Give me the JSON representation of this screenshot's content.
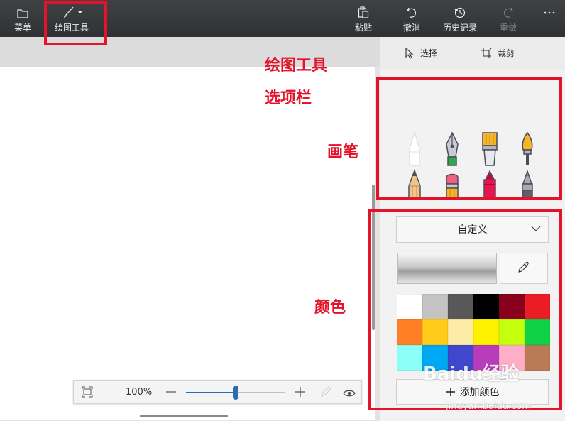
{
  "toolbar": {
    "menu_label": "菜单",
    "draw_tools_label": "绘图工具",
    "paste_label": "粘贴",
    "undo_label": "撤消",
    "history_label": "历史记录",
    "redo_label": "重做"
  },
  "zoom": {
    "percent_text": "100%",
    "level": 0.5
  },
  "pane": {
    "select_label": "选择",
    "crop_label": "裁剪",
    "brushes": [
      "marker-icon",
      "calligraphy-pen-icon",
      "oil-brush-icon",
      "watercolor-brush-icon",
      "pencil-icon",
      "eraser-icon",
      "crayon-icon",
      "pixel-pen-icon",
      "spray-can-icon",
      "fill-bucket-icon"
    ],
    "color_mode": "自定义",
    "add_color_label": "添加颜色",
    "palette": [
      "#ffffff",
      "#c3c3c3",
      "#585858",
      "#000000",
      "#88001b",
      "#ec1c24",
      "#ff7f27",
      "#ffca18",
      "#fdeca6",
      "#fff200",
      "#c4ff0e",
      "#0ed145",
      "#8cfffb",
      "#00a8f3",
      "#3f48cc",
      "#b83dba",
      "#ffaec8",
      "#b97a56"
    ]
  },
  "annotations": {
    "draw_tools_title": "绘图工具",
    "options_bar": "选项栏",
    "brush": "画笔",
    "color": "颜色"
  },
  "watermark": {
    "logo": "Baidu经验",
    "url": "jingyan.baidu.com"
  }
}
